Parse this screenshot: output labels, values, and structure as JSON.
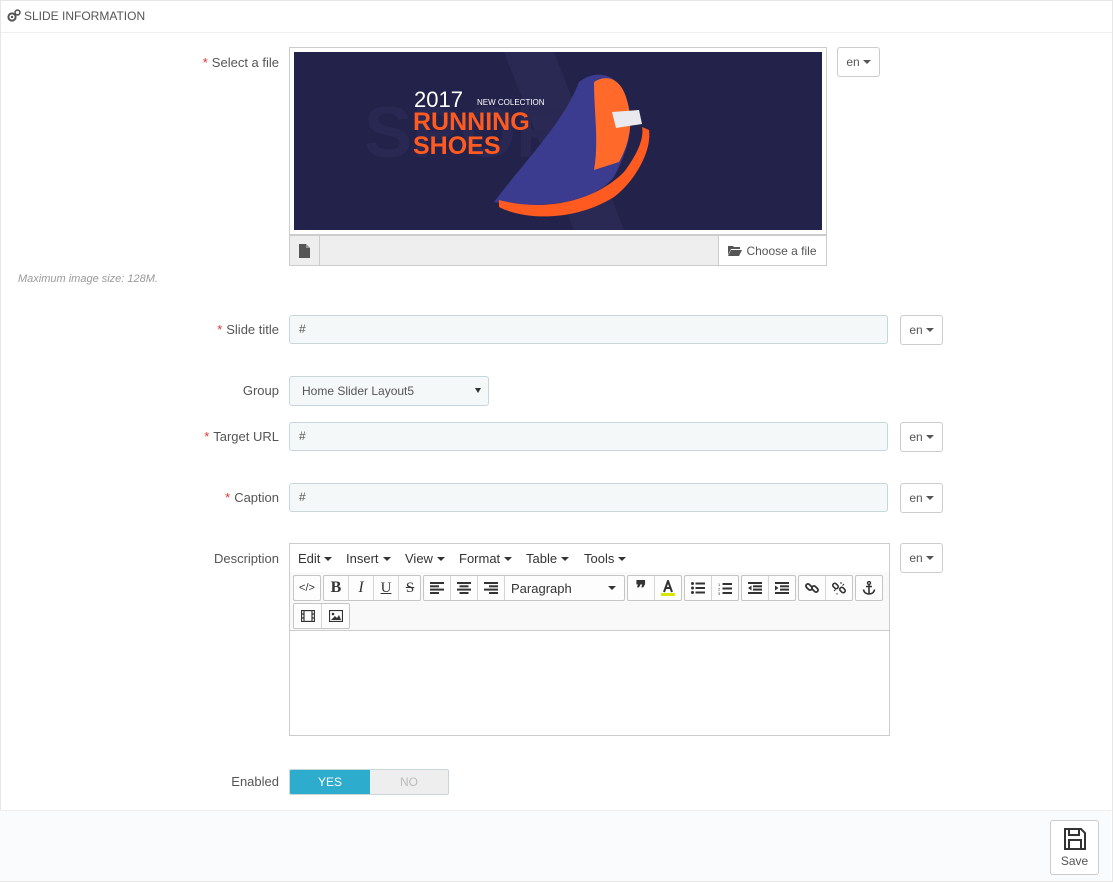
{
  "panel": {
    "title": "SLIDE INFORMATION"
  },
  "fields": {
    "file": {
      "label": "Select a file",
      "lang": "en",
      "choose_label": "Choose a file",
      "hint": "Maximum image size: 128M."
    },
    "banner": {
      "year": "2017",
      "sub": "NEW COLECTION",
      "line1": "RUNNING",
      "line2": "SHOES",
      "watermark": "SPORT"
    },
    "slide_title": {
      "label": "Slide title",
      "value": "#",
      "lang": "en"
    },
    "group": {
      "label": "Group",
      "value": "Home Slider Layout5"
    },
    "target_url": {
      "label": "Target URL",
      "value": "#",
      "lang": "en"
    },
    "caption": {
      "label": "Caption",
      "value": "#",
      "lang": "en"
    },
    "description": {
      "label": "Description",
      "lang": "en"
    },
    "enabled": {
      "label": "Enabled",
      "yes": "YES",
      "no": "NO",
      "value": true
    }
  },
  "editor": {
    "menus": [
      "Edit",
      "Insert",
      "View",
      "Format",
      "Table",
      "Tools"
    ],
    "format_select": "Paragraph"
  },
  "footer": {
    "save_label": "Save"
  }
}
